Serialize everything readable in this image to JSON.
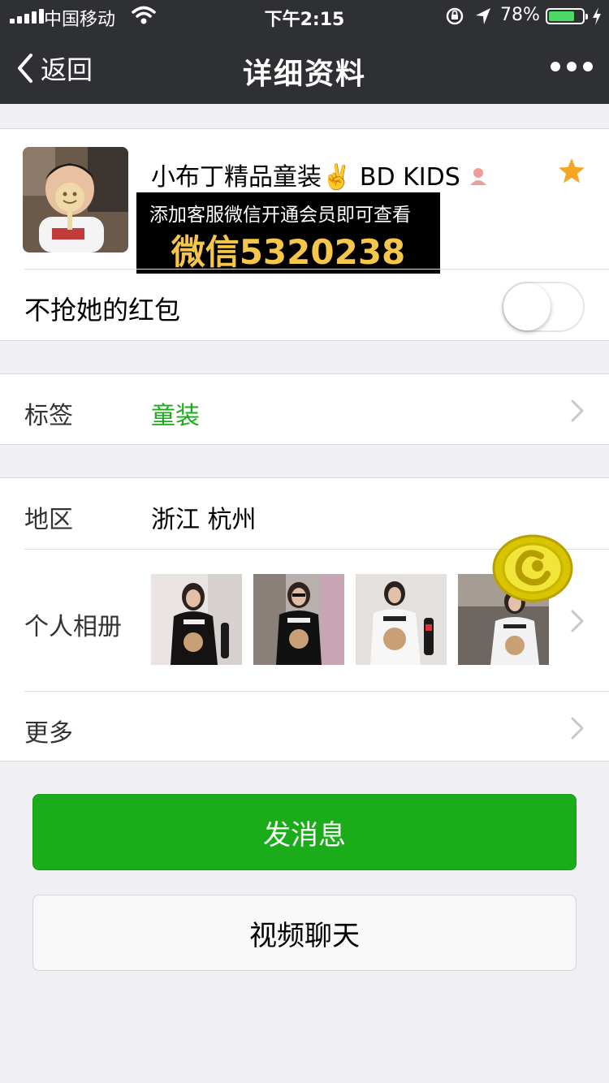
{
  "status_bar": {
    "carrier": "中国移动",
    "time": "下午2:15",
    "battery_percent": "78%",
    "battery_level": 0.78
  },
  "nav": {
    "back_label": "返回",
    "title": "详细资料"
  },
  "profile": {
    "nickname": "小布丁精品童装✌️ BD KIDS",
    "promo_line1": "添加客服微信开通会员即可查看",
    "promo_line2": "微信5320238",
    "no_red_packet_label": "不抢她的红包",
    "no_red_packet_on": false
  },
  "tag_row": {
    "label": "标签",
    "value": "童装"
  },
  "region_row": {
    "label": "地区",
    "value": "浙江 杭州"
  },
  "album_row": {
    "label": "个人相册"
  },
  "more_row": {
    "label": "更多"
  },
  "buttons": {
    "send_message": "发消息",
    "video_chat": "视频聊天"
  },
  "colors": {
    "nav_bg": "#2f3034",
    "accent_green": "#1aad19",
    "tag_green": "#1aad19",
    "star": "#f5a623",
    "promo_text": "#f6c64a",
    "battery_green": "#4cd964"
  }
}
